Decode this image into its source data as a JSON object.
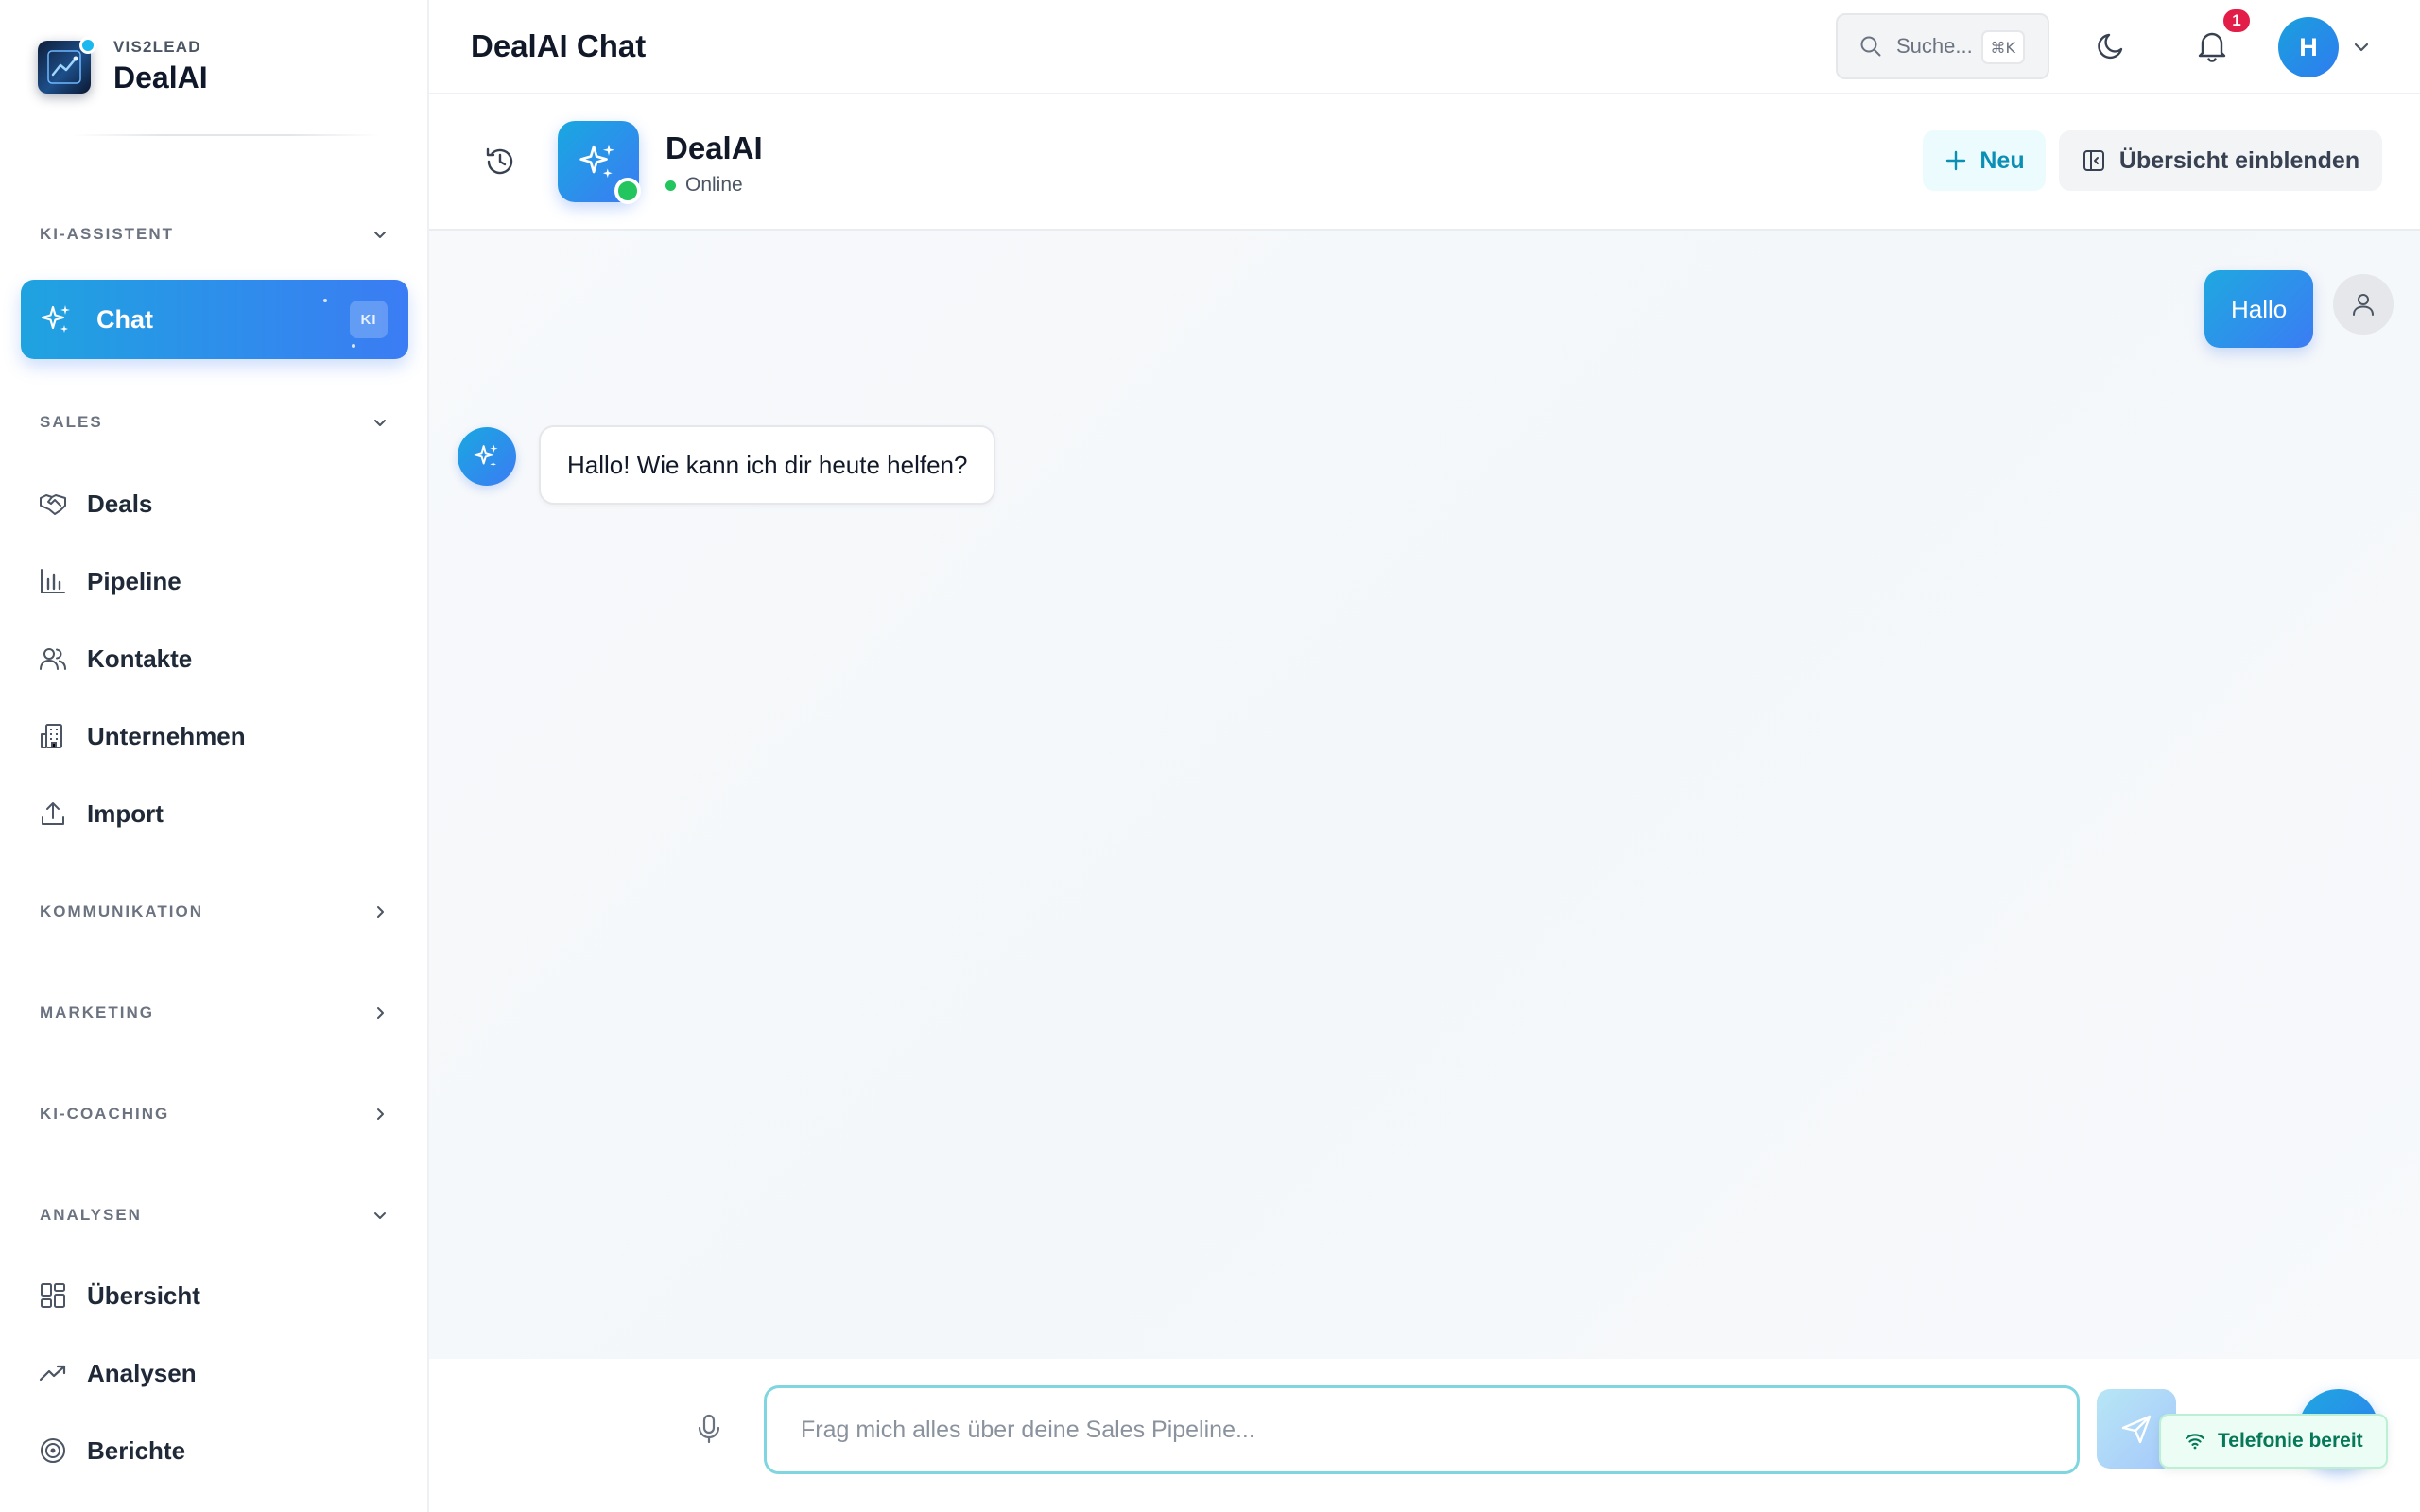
{
  "brand": {
    "subtitle": "VIS2LEAD",
    "name": "DealAI"
  },
  "sidebar": {
    "sections": {
      "ki_assistent": "KI-ASSISTENT",
      "sales": "SALES",
      "kommunikation": "KOMMUNIKATION",
      "marketing": "MARKETING",
      "ki_coaching": "KI-COACHING",
      "analysen": "ANALYSEN"
    },
    "chat": {
      "label": "Chat",
      "badge": "KI"
    },
    "sales_items": [
      "Deals",
      "Pipeline",
      "Kontakte",
      "Unternehmen",
      "Import"
    ],
    "analysen_items": [
      "Übersicht",
      "Analysen",
      "Berichte"
    ]
  },
  "topbar": {
    "title": "DealAI Chat",
    "search_placeholder": "Suche...",
    "search_shortcut": "⌘K",
    "notification_count": "1",
    "avatar_initial": "H"
  },
  "chat_header": {
    "bot_name": "DealAI",
    "status": "Online",
    "new_label": "Neu",
    "overview_label": "Übersicht einblenden"
  },
  "messages": {
    "user": "Hallo",
    "bot": "Hallo! Wie kann ich dir heute helfen?"
  },
  "input": {
    "placeholder": "Frag mich alles über deine Sales Pipeline...",
    "telefonie": "Telefonie bereit"
  },
  "colors": {
    "accent_start": "#1fa3e0",
    "accent_end": "#3b7cf4",
    "online": "#22c55e",
    "notification": "#e11d48"
  }
}
